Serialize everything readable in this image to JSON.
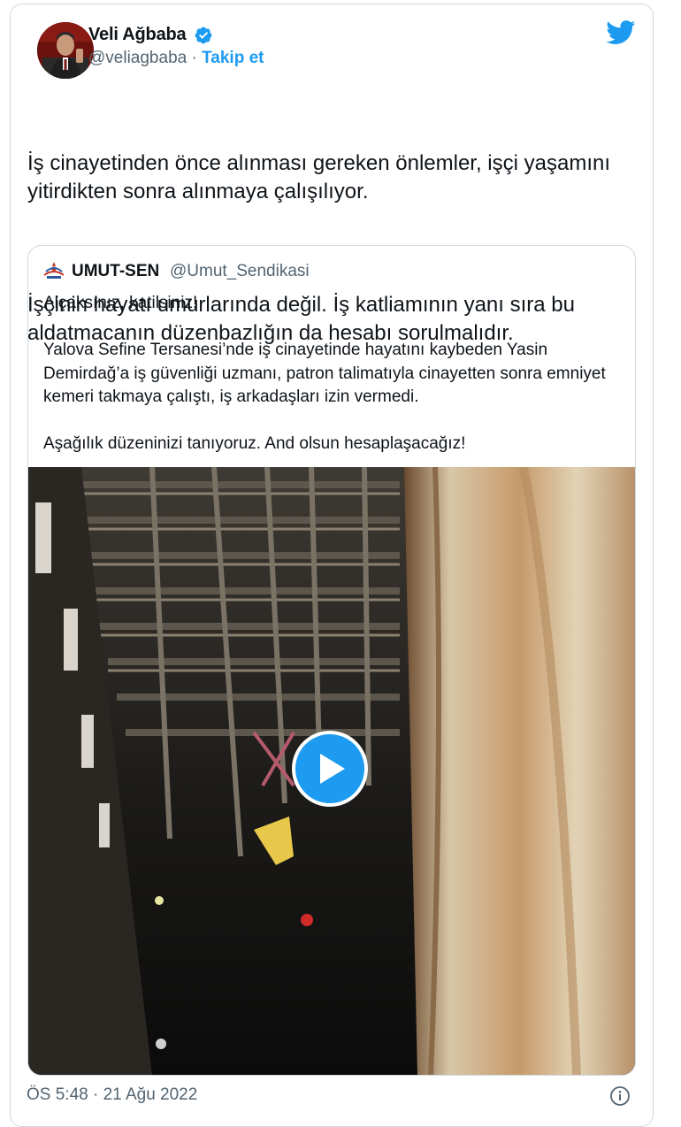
{
  "author": {
    "name": "Veli Ağbaba",
    "handle": "@veliagbaba",
    "separator": "·",
    "follow_label": "Takip et",
    "verified_icon": "verified-badge-icon",
    "avatar": "author-avatar"
  },
  "brand": {
    "icon": "twitter-bird-icon",
    "color": "#1d9bf0"
  },
  "tweet": {
    "paragraphs": [
      "İş cinayetinden önce alınması gereken önlemler, işçi yaşamını yitirdikten sonra alınmaya çalışılıyor.",
      "İşçinin hayatı umurlarında değil. İş katliamının yanı sıra bu aldatmacanın düzenbazlığın da hesabı sorulmalıdır."
    ]
  },
  "quoted": {
    "name": "UMUT-SEN",
    "handle": "@Umut_Sendikasi",
    "logo_icon": "umut-sen-logo-icon",
    "paragraphs": [
      "Alçaksınız, katilsiniz!",
      "Yalova Sefine Tersanesi’nde iş cinayetinde hayatını kaybeden Yasin Demirdağ’a iş güvenliği uzmanı, patron talimatıyla cinayetten sonra emniyet kemeri takmaya çalıştı, iş arkadaşları izin vermedi.",
      "Aşağılık düzeninizi tanıyoruz. And olsun hesaplaşacağız!"
    ],
    "media": {
      "type": "video",
      "play_icon": "play-icon"
    }
  },
  "footer": {
    "timestamp": "ÖS 5:48 · 21 Ağu 2022",
    "info_icon": "info-icon"
  }
}
